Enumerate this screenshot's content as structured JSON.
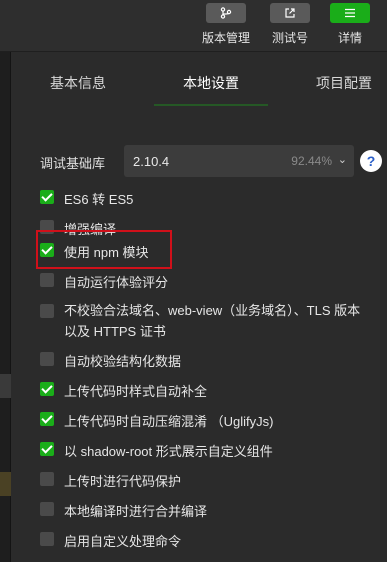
{
  "toolbar": {
    "buttons": [
      {
        "label": "版本管理",
        "icon": "branch-icon"
      },
      {
        "label": "测试号",
        "icon": "external-link-icon"
      },
      {
        "label": "详情",
        "icon": "menu-icon",
        "accent": "#1aad19"
      }
    ]
  },
  "tabs": [
    {
      "label": "基本信息",
      "active": false
    },
    {
      "label": "本地设置",
      "active": true
    },
    {
      "label": "项目配置",
      "active": false
    }
  ],
  "debug_lib": {
    "label": "调试基础库",
    "version": "2.10.4",
    "percent": "92.44%",
    "help": "?"
  },
  "options": [
    {
      "label": "ES6 转 ES5",
      "checked": true
    },
    {
      "label": "增强编译",
      "checked": false
    },
    {
      "label": "使用 npm 模块",
      "checked": true
    },
    {
      "label": "自动运行体验评分",
      "checked": false
    },
    {
      "label": "不校验合法域名、web-view（业务域名）、TLS 版本以及 HTTPS 证书",
      "checked": false
    },
    {
      "label": "自动校验结构化数据",
      "checked": false
    },
    {
      "label": "上传代码时样式自动补全",
      "checked": true
    },
    {
      "label": "上传代码时自动压缩混淆 （UglifyJs)",
      "checked": true
    },
    {
      "label": "以 shadow-root 形式展示自定义组件",
      "checked": true
    },
    {
      "label": "上传时进行代码保护",
      "checked": false
    },
    {
      "label": "本地编译时进行合并编译",
      "checked": false
    },
    {
      "label": "启用自定义处理命令",
      "checked": false
    }
  ],
  "colors": {
    "accent": "#1aad19",
    "highlight": "#d0101a"
  }
}
